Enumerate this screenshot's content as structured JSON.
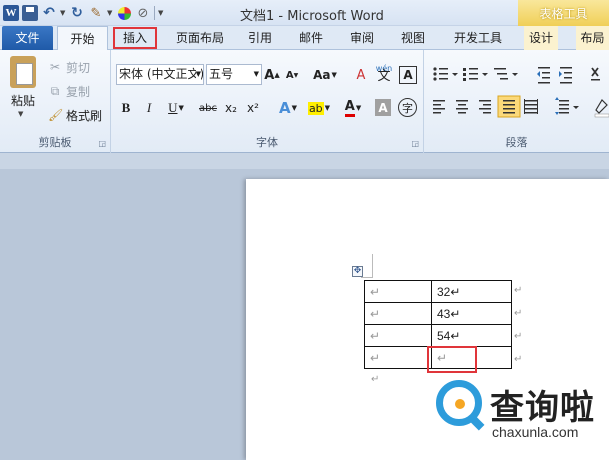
{
  "app": {
    "window_title": "文档1 - Microsoft Word",
    "context_group_title": "表格工具"
  },
  "quick_access": {
    "icons": [
      "word-app-icon",
      "save-icon",
      "undo-icon",
      "redo-icon",
      "format-painter-icon",
      "color-icon",
      "shape-icon",
      "customize-dropdown-icon"
    ]
  },
  "tabs": [
    "文件",
    "开始",
    "插入",
    "页面布局",
    "引用",
    "邮件",
    "审阅",
    "视图",
    "开发工具",
    "设计",
    "布局"
  ],
  "ribbon": {
    "clipboard": {
      "group_label": "剪贴板",
      "paste": "粘贴",
      "cut": "剪切",
      "copy": "复制",
      "format_painter": "格式刷"
    },
    "font": {
      "group_label": "字体",
      "font_name": "宋体 (中文正文)",
      "font_size": "五号",
      "grow_font": "A",
      "shrink_font": "A",
      "change_case": "Aa",
      "clear_format": "A",
      "phonetic": "wén",
      "char_border": "A",
      "bold": "B",
      "italic": "I",
      "underline": "U",
      "strikethrough": "abc",
      "subscript": "x₂",
      "superscript": "x²",
      "text_effects": "A",
      "highlight": "ab",
      "font_color": "A",
      "char_shading": "A",
      "enclose_char": "字"
    },
    "paragraph": {
      "group_label": "段落"
    }
  },
  "document": {
    "table": [
      [
        "↵",
        "32↵"
      ],
      [
        "↵",
        "43↵"
      ],
      [
        "↵",
        "54↵"
      ],
      [
        "↵",
        "↵"
      ]
    ],
    "row_end_mark": "↵",
    "para_mark": "↵"
  },
  "watermark": {
    "text": "查询啦",
    "url": "chaxunla.com"
  },
  "colors": {
    "highlight_border": "#e0353a",
    "file_tab": "#2b65b4",
    "context_tab": "#f0cf57"
  }
}
